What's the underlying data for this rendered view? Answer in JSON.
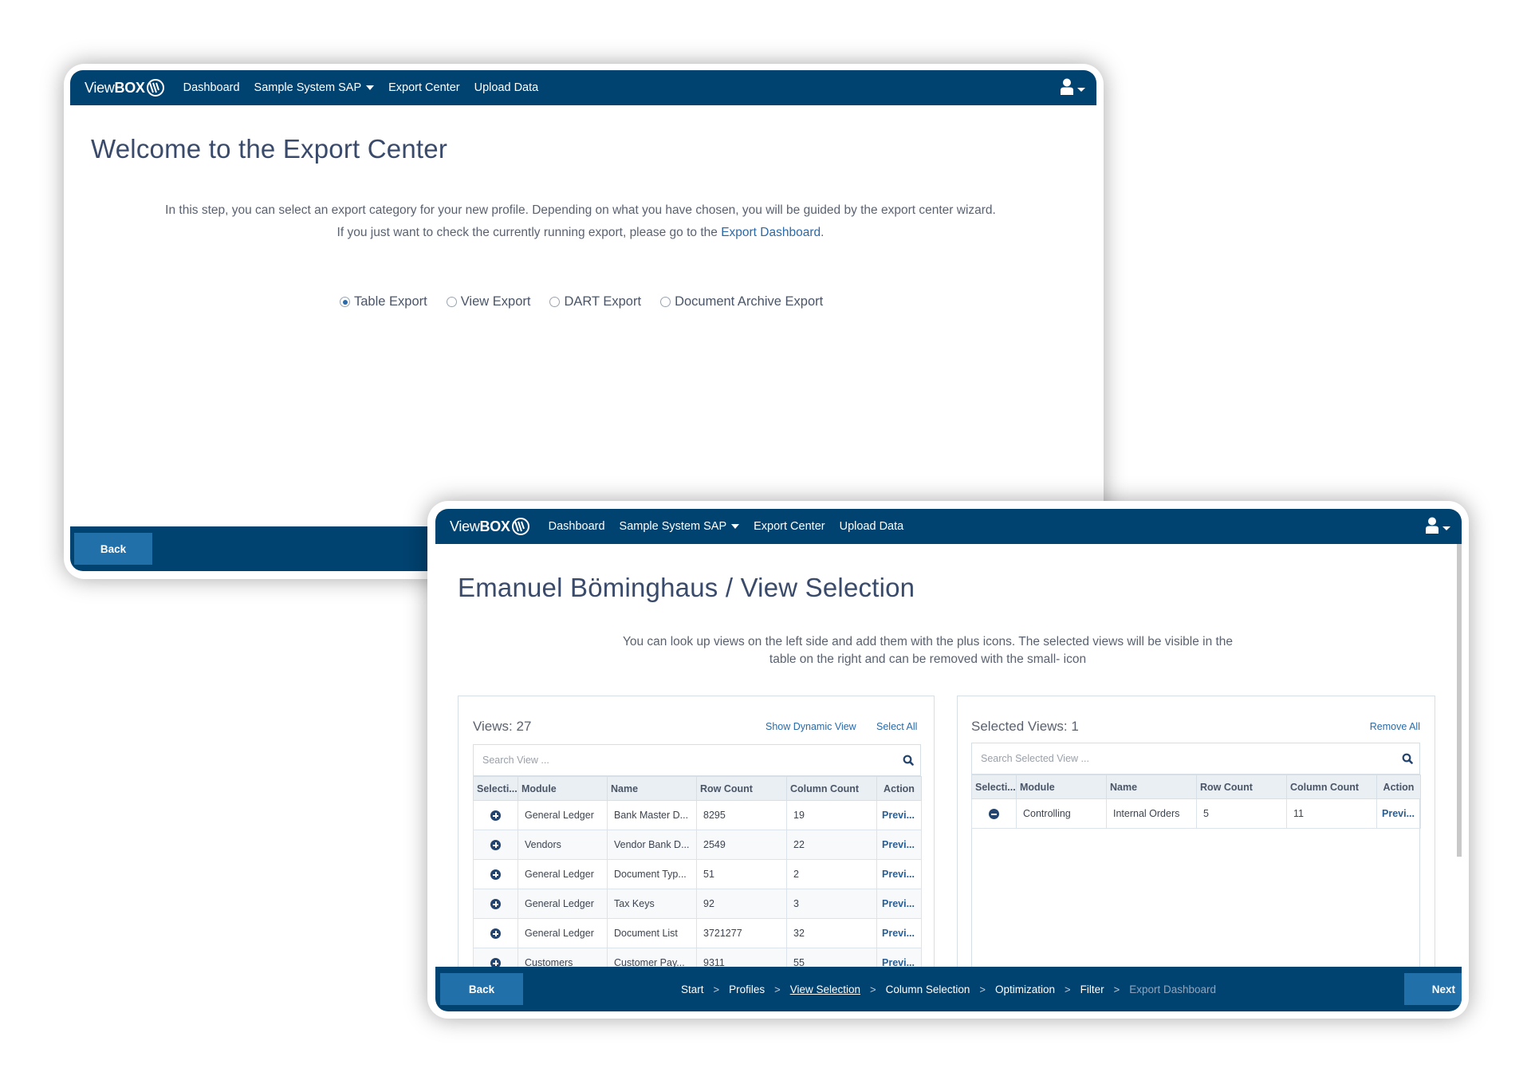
{
  "brand": {
    "logo_prefix": "View",
    "logo_bold": "BOX"
  },
  "nav": {
    "items": [
      "Dashboard",
      "Sample System SAP",
      "Export Center",
      "Upload Data"
    ],
    "dropdown_item_index": 1,
    "user_icon": "user-icon"
  },
  "export_center": {
    "title": "Welcome to the Export Center",
    "description_line1": "In this step, you can select an export category for your new profile. Depending on what you have chosen, you will be guided by the export center wizard.",
    "description_line2_prefix": "If you just want to check the currently running export, please go to the ",
    "description_link": "Export Dashboard",
    "description_line2_suffix": ".",
    "export_types": [
      {
        "label": "Table Export",
        "checked": true
      },
      {
        "label": "View Export",
        "checked": false
      },
      {
        "label": "DART Export",
        "checked": false
      },
      {
        "label": "Document Archive Export",
        "checked": false
      }
    ],
    "back_label": "Back"
  },
  "view_selection": {
    "title": "Emanuel Böminghaus / View Selection",
    "description_line1": "You can look up views on the left side and add them with the plus icons. The selected views will be visible in the",
    "description_line2": "table on the right and can be removed with the small- icon",
    "left_panel": {
      "title": "Views: 27",
      "show_dynamic_label": "Show Dynamic View",
      "select_all_label": "Select All",
      "search_placeholder": "Search View ...",
      "columns": [
        "Selecti...",
        "Module",
        "Name",
        "Row Count",
        "Column Count",
        "Action"
      ],
      "rows": [
        {
          "module": "General Ledger",
          "name": "Bank Master D...",
          "row_count": "8295",
          "column_count": "19",
          "action": "Previ..."
        },
        {
          "module": "Vendors",
          "name": "Vendor Bank D...",
          "row_count": "2549",
          "column_count": "22",
          "action": "Previ..."
        },
        {
          "module": "General Ledger",
          "name": "Document Typ...",
          "row_count": "51",
          "column_count": "2",
          "action": "Previ..."
        },
        {
          "module": "General Ledger",
          "name": "Tax Keys",
          "row_count": "92",
          "column_count": "3",
          "action": "Previ..."
        },
        {
          "module": "General Ledger",
          "name": "Document List",
          "row_count": "3721277",
          "column_count": "32",
          "action": "Previ..."
        },
        {
          "module": "Customers",
          "name": "Customer Pay...",
          "row_count": "9311",
          "column_count": "55",
          "action": "Previ..."
        }
      ]
    },
    "right_panel": {
      "title": "Selected Views: 1",
      "remove_all_label": "Remove All",
      "search_placeholder": "Search Selected View ...",
      "columns": [
        "Selecti...",
        "Module",
        "Name",
        "Row Count",
        "Column Count",
        "Action"
      ],
      "rows": [
        {
          "module": "Controlling",
          "name": "Internal Orders",
          "row_count": "5",
          "column_count": "11",
          "action": "Previ..."
        }
      ]
    },
    "back_label": "Back",
    "next_label": "Next",
    "wizard_steps": [
      {
        "label": "Start",
        "state": "done"
      },
      {
        "label": "Profiles",
        "state": "done"
      },
      {
        "label": "View Selection",
        "state": "current"
      },
      {
        "label": "Column Selection",
        "state": "done"
      },
      {
        "label": "Optimization",
        "state": "done"
      },
      {
        "label": "Filter",
        "state": "done"
      },
      {
        "label": "Export Dashboard",
        "state": "disabled"
      }
    ],
    "step_separator": ">"
  },
  "colors": {
    "navbar": "#004270",
    "button": "#2270aa",
    "link": "#2a6aa8",
    "title": "#3a4a6b"
  }
}
